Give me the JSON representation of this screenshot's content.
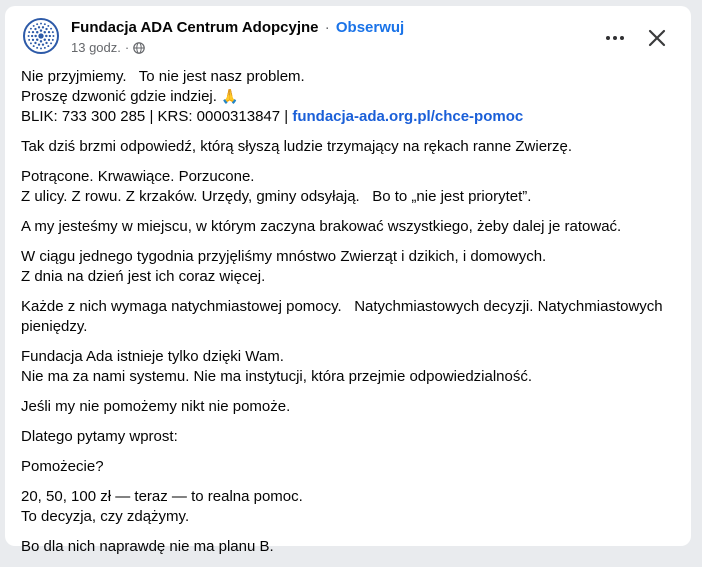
{
  "post": {
    "page_name": "Fundacja ADA Centrum Adopcyjne",
    "separator": "·",
    "follow_label": "Obserwuj",
    "time": "13 godz.",
    "visibility_icon": "globe-icon",
    "more_icon": "more-dots-icon",
    "close_icon": "close-icon",
    "accent_color": "#1a73e8"
  },
  "content": {
    "l1": "Nie przyjmiemy.   To nie jest nasz problem.",
    "l2": "Proszę dzwonić gdzie indziej. ",
    "l2_emoji": "🙏",
    "l3_prefix": "BLIK: 733 300 285 | KRS: 0000313847 | ",
    "l3_link": "fundacja-ada.org.pl/chce-pomoc",
    "p2": "Tak dziś brzmi odpowiedź, którą słyszą ludzie trzymający na rękach ranne Zwierzę.",
    "p3a": "Potrącone. Krwawiące. Porzucone.",
    "p3b": "Z ulicy. Z rowu. Z krzaków. Urzędy, gminy odsyłają.   Bo to „nie jest priorytet”.",
    "p4": "A my jesteśmy w miejscu, w którym zaczyna brakować wszystkiego, żeby dalej je ratować.",
    "p5a": "W ciągu jednego tygodnia przyjęliśmy mnóstwo Zwierząt i dzikich, i domowych.",
    "p5b": "Z dnia na dzień jest ich coraz więcej.",
    "p6": "Każde z nich wymaga natychmiastowej pomocy.   Natychmiastowych decyzji. Natychmiastowych pieniędzy.",
    "p7a": "Fundacja Ada istnieje tylko dzięki Wam.",
    "p7b": "Nie ma za nami systemu. Nie ma instytucji, która przejmie odpowiedzialność.",
    "p8": "Jeśli my nie pomożemy nikt nie pomoże.",
    "p9": "Dlatego pytamy wprost:",
    "p10": "Pomożecie?",
    "p11a": "20, 50, 100 zł — teraz — to realna pomoc.",
    "p11b": "To decyzja, czy zdążymy.",
    "p12": "Bo dla nich naprawdę nie ma planu B."
  }
}
